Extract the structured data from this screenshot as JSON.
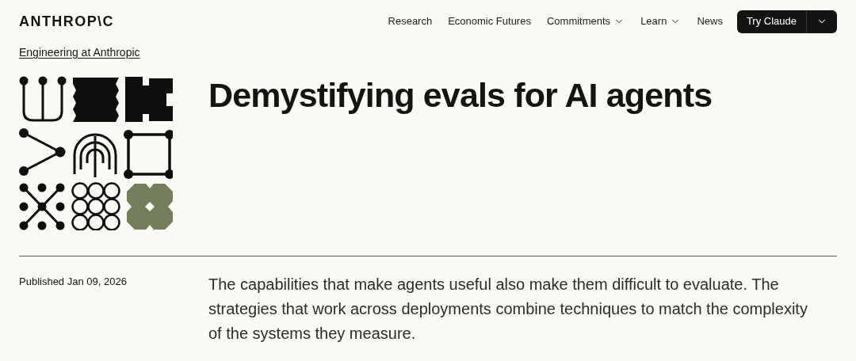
{
  "header": {
    "logo": "ANTHROP\\C",
    "nav": [
      {
        "label": "Research",
        "has_menu": false
      },
      {
        "label": "Economic Futures",
        "has_menu": false
      },
      {
        "label": "Commitments",
        "has_menu": true
      },
      {
        "label": "Learn",
        "has_menu": true
      },
      {
        "label": "News",
        "has_menu": false
      }
    ],
    "cta": {
      "label": "Try Claude"
    }
  },
  "breadcrumb": "Engineering at Anthropic",
  "article": {
    "title": "Demystifying evals for AI agents",
    "published": "Published Jan 09, 2026",
    "summary": "The capabilities that make agents useful also make them difficult to evaluate. The strategies that work across deployments combine techniques to match the complexity of the systems they measure."
  }
}
